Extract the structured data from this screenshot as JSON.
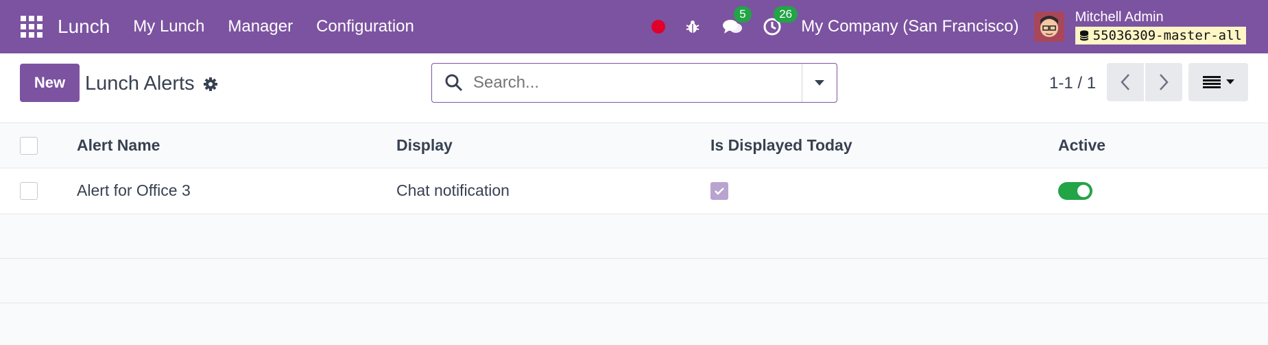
{
  "navbar": {
    "app_name": "Lunch",
    "menus": [
      "My Lunch",
      "Manager",
      "Configuration"
    ],
    "chat_badge": "5",
    "activity_badge": "26",
    "company": "My Company (San Francisco)",
    "user_name": "Mitchell Admin",
    "database": "55036309-master-all"
  },
  "control_panel": {
    "new_label": "New",
    "title": "Lunch Alerts",
    "search_placeholder": "Search...",
    "pager": "1-1 / 1"
  },
  "table": {
    "headers": [
      "Alert Name",
      "Display",
      "Is Displayed Today",
      "Active"
    ],
    "rows": [
      {
        "name": "Alert for Office 3",
        "display": "Chat notification",
        "displayed_today": true,
        "active": true
      }
    ]
  },
  "colors": {
    "brand": "#7c53a0",
    "success": "#22a447"
  }
}
